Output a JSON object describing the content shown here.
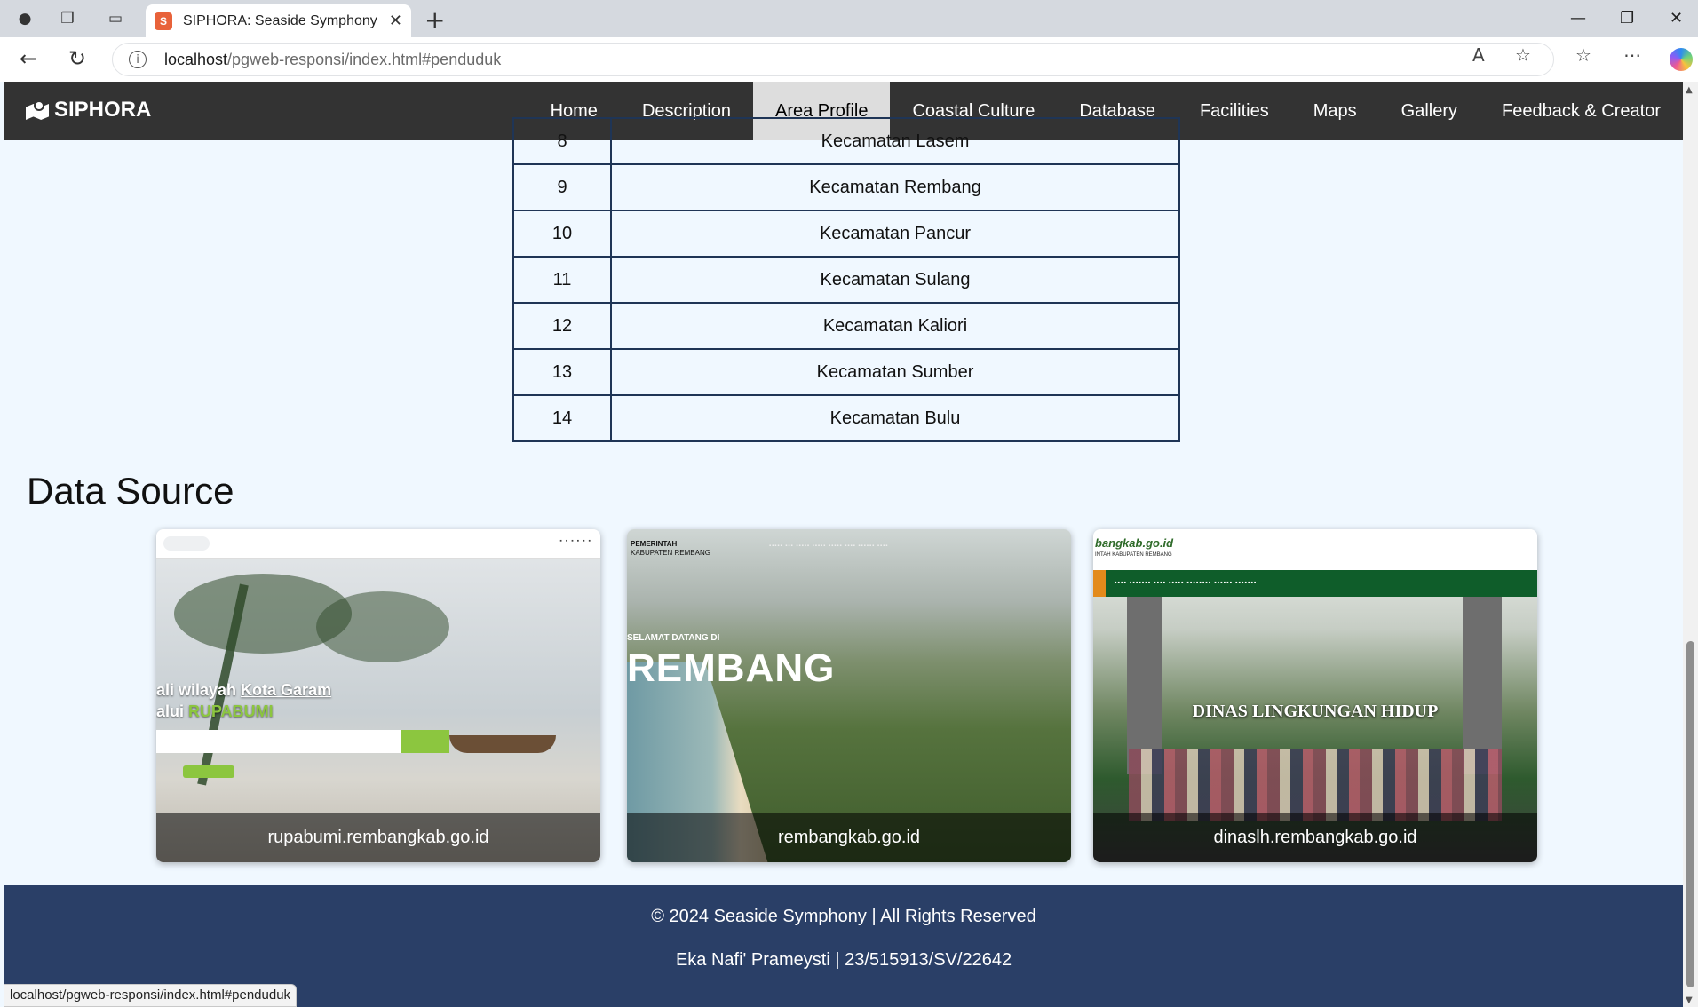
{
  "browser": {
    "tab_title": "SIPHORA: Seaside Symphony Rembang",
    "url_host": "localhost",
    "url_path": "/pgweb-responsi/index.html#penduduk",
    "status_url": "localhost/pgweb-responsi/index.html#penduduk"
  },
  "nav": {
    "brand": "SIPHORA",
    "items": [
      {
        "label": "Home"
      },
      {
        "label": "Description"
      },
      {
        "label": "Area Profile",
        "active": true
      },
      {
        "label": "Coastal Culture"
      },
      {
        "label": "Database"
      },
      {
        "label": "Facilities"
      },
      {
        "label": "Maps"
      },
      {
        "label": "Gallery"
      },
      {
        "label": "Feedback & Creator"
      }
    ]
  },
  "districts_table": {
    "rows": [
      {
        "no": "8",
        "name": "Kecamatan Lasem"
      },
      {
        "no": "9",
        "name": "Kecamatan Rembang"
      },
      {
        "no": "10",
        "name": "Kecamatan Pancur"
      },
      {
        "no": "11",
        "name": "Kecamatan Sulang"
      },
      {
        "no": "12",
        "name": "Kecamatan Kaliori"
      },
      {
        "no": "13",
        "name": "Kecamatan Sumber"
      },
      {
        "no": "14",
        "name": "Kecamatan Bulu"
      }
    ]
  },
  "data_source": {
    "title": "Data Source",
    "cards": [
      {
        "caption": "rupabumi.rembangkab.go.id",
        "hero_line1_a": "ali wilayah ",
        "hero_line1_b": "Kota Garam",
        "hero_line2_a": "alui ",
        "hero_line2_b": "RUPABUMI"
      },
      {
        "caption": "rembangkab.go.id",
        "org_line1": "PEMERINTAH",
        "org_line2": "KABUPATEN REMBANG",
        "welcome": "SELAMAT DATANG DI",
        "big": "REMBANG"
      },
      {
        "caption": "dinaslh.rembangkab.go.id",
        "logo": "bangkab.go.id",
        "sub": "INTAH KABUPATEN REMBANG",
        "hero": "DINAS LINGKUNGAN HIDUP"
      }
    ]
  },
  "footer": {
    "copyright": "© 2024 Seaside Symphony | All Rights Reserved",
    "author": "Eka Nafi' Prameysti | 23/515913/SV/22642"
  },
  "colors": {
    "nav_bg": "#333333",
    "page_bg": "#f0f8ff",
    "footer_bg": "#2a3f67",
    "table_border": "#1f3556"
  }
}
